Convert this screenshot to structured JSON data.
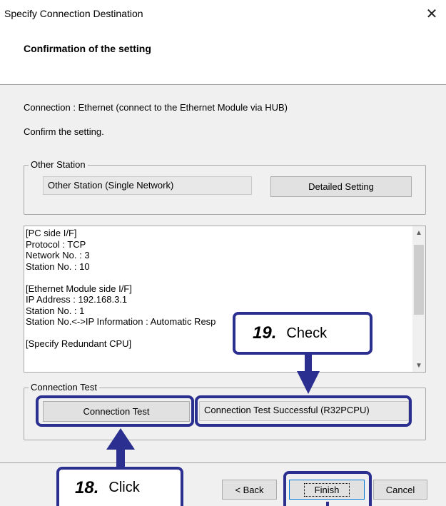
{
  "window": {
    "title": "Specify Connection Destination",
    "close_glyph": "✕"
  },
  "header": {
    "title": "Confirmation of the setting"
  },
  "connection_text": "Connection : Ethernet (connect to the Ethernet Module via HUB)",
  "confirm_text": "Confirm the setting.",
  "other_station": {
    "legend": "Other Station",
    "value": "Other Station (Single Network)",
    "detailed_button": "Detailed Setting"
  },
  "info_lines": [
    "[PC side I/F]",
    "Protocol : TCP",
    "Network No. : 3",
    "Station No. : 10",
    "",
    "[Ethernet Module side I/F]",
    "IP Address : 192.168.3.1",
    "Station No. : 1",
    "Station No.<->IP Information : Automatic Resp",
    "",
    "[Specify Redundant CPU]"
  ],
  "connection_test": {
    "legend": "Connection Test",
    "button": "Connection Test",
    "result": "Connection Test Successful (R32PCPU)"
  },
  "footer": {
    "back_button": "< Back",
    "finish_button": "Finish",
    "cancel_button": "Cancel"
  },
  "callouts": {
    "check": {
      "number": "19.",
      "word": "Check"
    },
    "click": {
      "number": "18.",
      "word": "Click"
    }
  },
  "colors": {
    "callout_accent": "#2b2f8f"
  }
}
